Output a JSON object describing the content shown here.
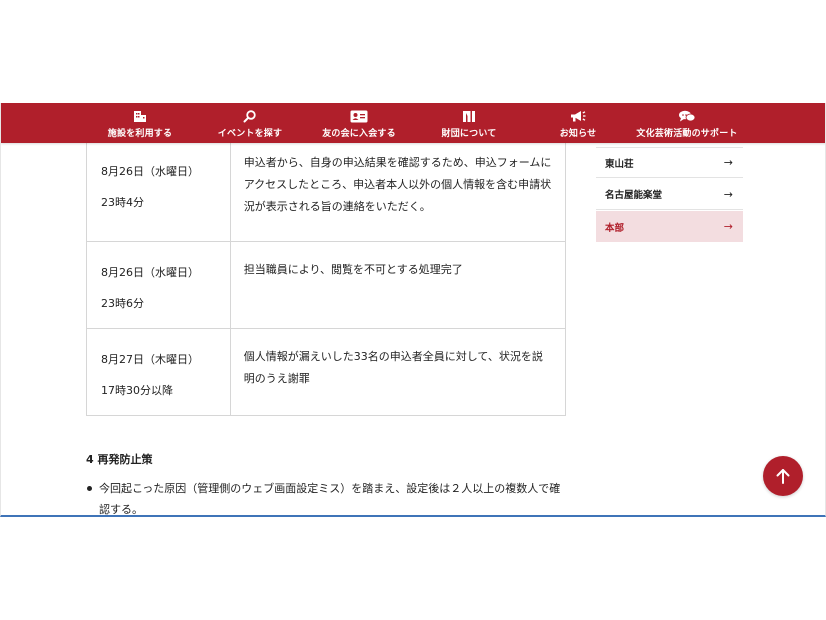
{
  "nav": {
    "items": [
      {
        "label": "施設を利用する",
        "icon": "building-icon"
      },
      {
        "label": "イベントを探す",
        "icon": "search-icon"
      },
      {
        "label": "友の会に入会する",
        "icon": "member-card-icon"
      },
      {
        "label": "財団について",
        "icon": "foundation-logo-icon"
      },
      {
        "label": "お知らせ",
        "icon": "megaphone-icon"
      },
      {
        "label": "文化芸術活動のサポート",
        "icon": "chat-bubbles-icon"
      }
    ]
  },
  "timeline": {
    "rows": [
      {
        "date": "8月26日（水曜日）",
        "time": "23時4分",
        "description": "申込者から、自身の申込結果を確認するため、申込フォームにアクセスしたところ、申込者本人以外の個人情報を含む申請状況が表示される旨の連絡をいただく。"
      },
      {
        "date": "8月26日（水曜日）",
        "time": "23時6分",
        "description": "担当職員により、閲覧を不可とする処理完了"
      },
      {
        "date": "8月27日（木曜日）",
        "time": "17時30分以降",
        "description": "個人情報が漏えいした33名の申込者全員に対して、状況を説明のうえ謝罪"
      }
    ]
  },
  "section": {
    "heading": "4 再発防止策",
    "bullets": [
      "今回起こった原因（管理側のウェブ画面設定ミス）を踏まえ、設定後は２人以上の複数人で確認する。"
    ]
  },
  "sidebar": {
    "items": [
      {
        "label": "東山荘",
        "arrow": "→",
        "active": false
      },
      {
        "label": "名古屋能楽堂",
        "arrow": "→",
        "active": false
      },
      {
        "label": "本部",
        "arrow": "→",
        "active": true
      }
    ]
  },
  "colors": {
    "brand": "#b01f2b",
    "active_bg": "#f3dde0"
  },
  "scroll_top": {
    "icon": "arrow-up-icon"
  }
}
